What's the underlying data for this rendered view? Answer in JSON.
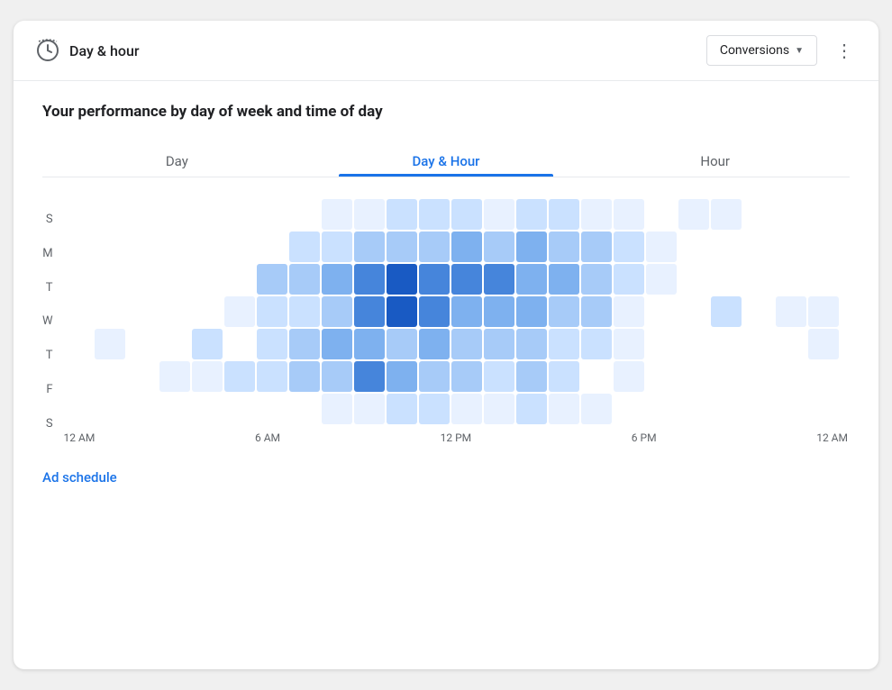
{
  "header": {
    "title": "Day & hour",
    "conversions_label": "Conversions",
    "more_icon": "⋮"
  },
  "subtitle": "Your performance by day of week and time of day",
  "tabs": [
    {
      "label": "Day",
      "active": false
    },
    {
      "label": "Day & Hour",
      "active": true
    },
    {
      "label": "Hour",
      "active": false
    }
  ],
  "y_axis_labels": [
    "S",
    "M",
    "T",
    "W",
    "T",
    "F",
    "S"
  ],
  "x_axis_labels": [
    "12 AM",
    "6 AM",
    "12 PM",
    "6 PM",
    "12 AM"
  ],
  "ad_schedule_label": "Ad schedule",
  "heatmap": {
    "rows": 7,
    "cols": 24,
    "colors": {
      "0": "rgba(200,218,255,0.0)",
      "1": "rgba(180,210,255,0.25)",
      "2": "rgba(160,200,255,0.45)",
      "3": "rgba(130,180,255,0.6)",
      "4": "rgba(100,155,240,0.75)",
      "5": "rgba(70,130,220,0.9)",
      "6": "rgba(30,100,200,1.0)"
    },
    "grid": [
      [
        0,
        0,
        0,
        0,
        0,
        0,
        0,
        0,
        1,
        1,
        2,
        2,
        2,
        1,
        2,
        2,
        1,
        1,
        0,
        1,
        1,
        0,
        0,
        0
      ],
      [
        0,
        0,
        0,
        0,
        0,
        0,
        0,
        2,
        2,
        3,
        3,
        3,
        4,
        3,
        4,
        3,
        3,
        2,
        1,
        0,
        0,
        0,
        0,
        0
      ],
      [
        0,
        0,
        0,
        0,
        0,
        0,
        3,
        3,
        4,
        5,
        6,
        5,
        5,
        5,
        4,
        4,
        3,
        2,
        1,
        0,
        0,
        0,
        0,
        0
      ],
      [
        0,
        0,
        0,
        0,
        0,
        1,
        2,
        2,
        3,
        5,
        6,
        5,
        4,
        4,
        4,
        3,
        3,
        1,
        0,
        0,
        2,
        0,
        1,
        1
      ],
      [
        0,
        1,
        0,
        0,
        2,
        0,
        2,
        3,
        4,
        4,
        3,
        4,
        3,
        3,
        3,
        2,
        2,
        1,
        0,
        0,
        0,
        0,
        0,
        1
      ],
      [
        0,
        0,
        0,
        1,
        1,
        2,
        2,
        3,
        3,
        5,
        4,
        3,
        3,
        2,
        3,
        2,
        0,
        1,
        0,
        0,
        0,
        0,
        0,
        0
      ],
      [
        0,
        0,
        0,
        0,
        0,
        0,
        0,
        0,
        1,
        1,
        2,
        2,
        1,
        1,
        2,
        1,
        1,
        0,
        0,
        0,
        0,
        0,
        0,
        0
      ]
    ]
  },
  "colors": {
    "accent": "#1a73e8"
  }
}
